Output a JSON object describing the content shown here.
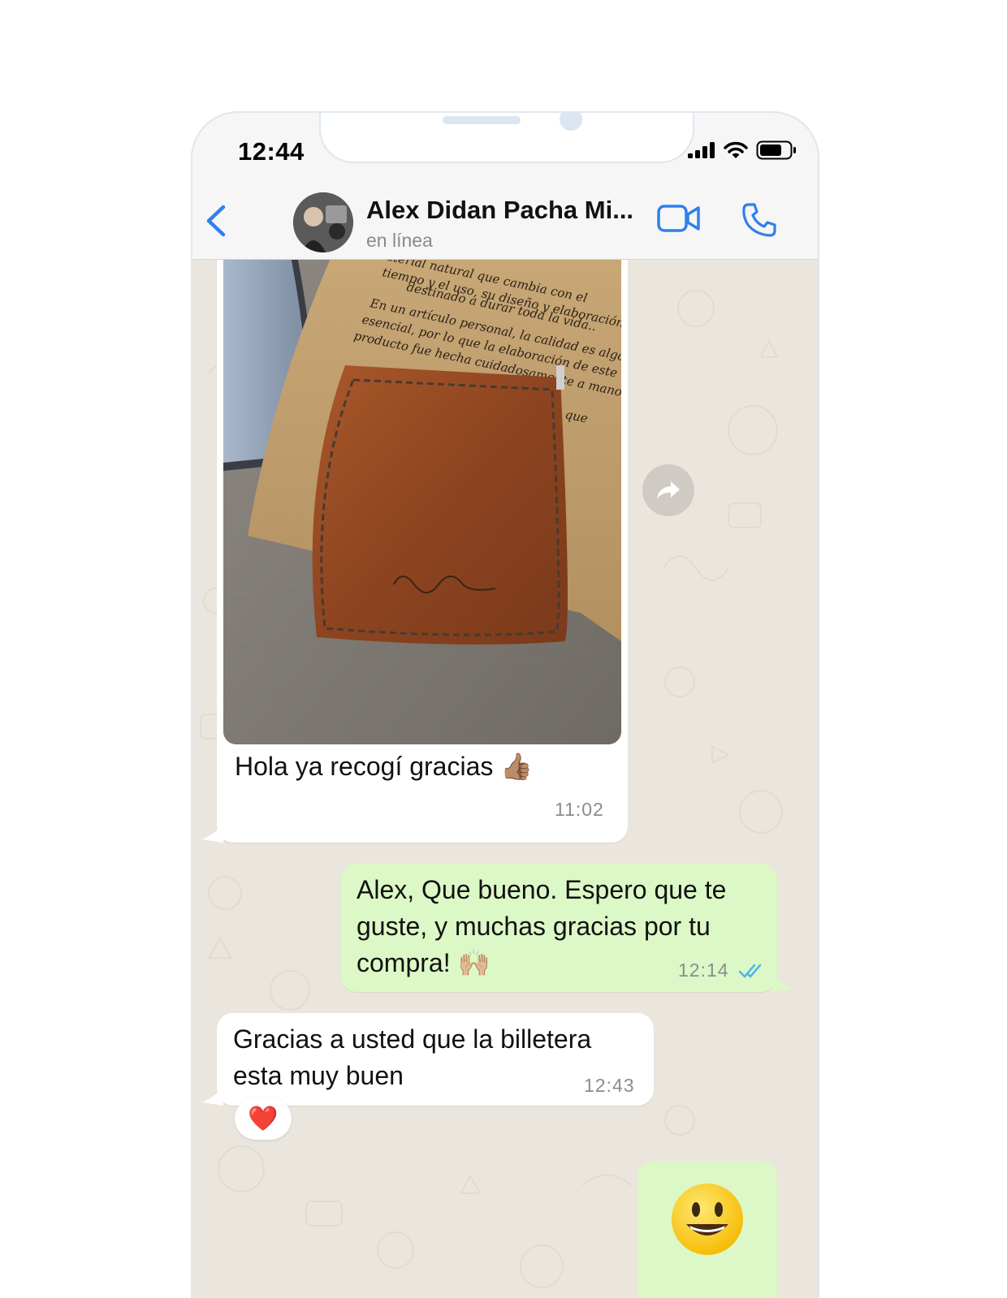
{
  "status_bar": {
    "time": "12:44"
  },
  "header": {
    "contact_name": "Alex Didan Pacha Mi...",
    "contact_status": "en línea"
  },
  "messages": [
    {
      "id": "m1",
      "direction": "incoming",
      "has_image": true,
      "image_text": "aterial natural que cambia con el tiempo y el uso, su diseño y elaboración está destinado a durar toda la vida.. En un artículo personal, la calidad es algo esencial, por lo que la elaboración de este producto fue hecha cuidadosamente a mano.",
      "text": "Hola ya recogí gracias 👍🏽",
      "time": "11:02"
    },
    {
      "id": "m2",
      "direction": "outgoing",
      "text": "Alex, Que bueno. Espero que te guste, y muchas gracias por tu compra! 🙌🏼",
      "line1": "Alex, Que bueno. Espero que te",
      "line2": "guste, y muchas gracias por tu",
      "line3": "compra! 🙌🏼",
      "time": "12:14",
      "status": "read"
    },
    {
      "id": "m3",
      "direction": "incoming",
      "line1": "Gracias a usted que la billetera",
      "line2": "esta muy buen",
      "time": "12:43",
      "reaction": "❤️"
    },
    {
      "id": "m4",
      "direction": "outgoing",
      "text": "😃"
    }
  ],
  "colors": {
    "accent": "#2f80ed",
    "outgoing_bubble": "#dcf8c6",
    "incoming_bubble": "#ffffff",
    "chat_background": "#ebe6dd",
    "read_ticks": "#4fb5ec"
  }
}
